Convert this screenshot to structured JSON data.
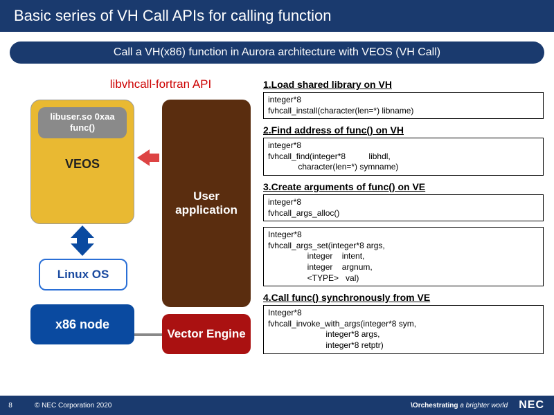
{
  "title": "Basic series of VH Call APIs for calling function",
  "subtitle": "Call a VH(x86) function in Aurora architecture with VEOS (VH Call)",
  "diagram": {
    "api_label": "libvhcall-fortran API",
    "lib_box": "libuser.so\n0xaa func()",
    "veos": "VEOS",
    "user_app": "User application",
    "linux": "Linux OS",
    "x86": "x86\nnode",
    "ve": "Vector\nEngine"
  },
  "steps": [
    {
      "title": "1.Load shared library on VH",
      "codes": [
        "integer*8\nfvhcall_install(character(len=*) libname)"
      ]
    },
    {
      "title": "2.Find address of func() on VH",
      "codes": [
        "integer*8\nfvhcall_find(integer*8          libhdl,\n             character(len=*) symname)"
      ]
    },
    {
      "title": "3.Create arguments of func() on VE",
      "codes": [
        "integer*8\nfvhcall_args_alloc()",
        "Integer*8\nfvhcall_args_set(integer*8 args,\n                 integer    intent,\n                 integer    argnum,\n                 <TYPE>   val)"
      ]
    },
    {
      "title": "4.Call func() synchronously from VE",
      "codes": [
        "Integer*8\nfvhcall_invoke_with_args(integer*8 sym,\n                         integer*8 args,\n                         integer*8 retptr)"
      ]
    }
  ],
  "footer": {
    "page": "8",
    "copyright": "© NEC Corporation 2020",
    "tagline_prefix": "\\Orchestrating",
    "tagline_rest": " a brighter world",
    "logo": "NEC"
  }
}
